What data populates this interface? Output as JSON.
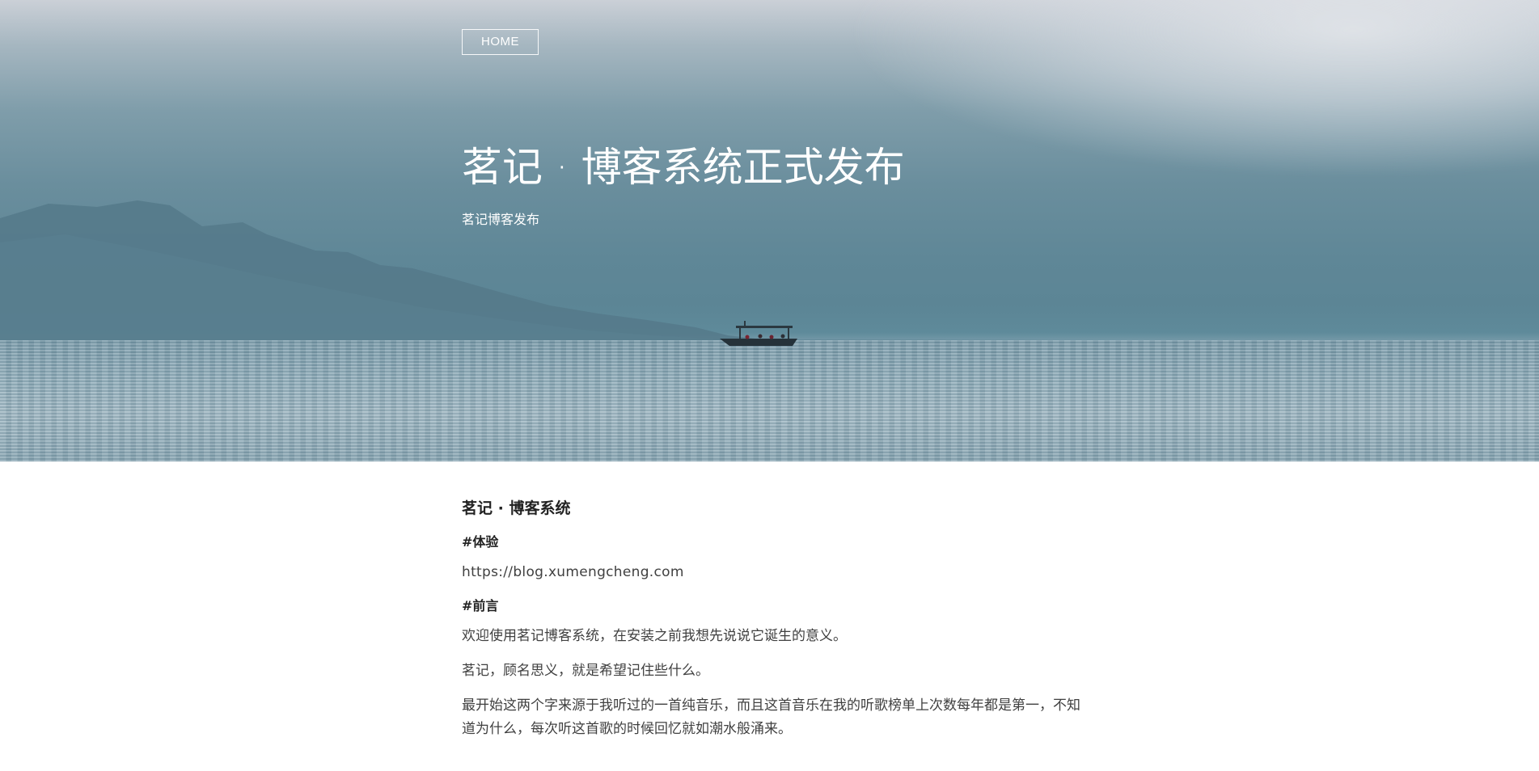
{
  "header": {
    "home_label": "HOME",
    "title": "茗记 · 博客系统正式发布",
    "subtitle": "茗记博客发布"
  },
  "article": {
    "heading": "茗记 · 博客系统",
    "section_experience": "#体验",
    "url": "https://blog.xumengcheng.com",
    "section_preface": "#前言",
    "paragraphs": [
      "欢迎使用茗记博客系统，在安装之前我想先说说它诞生的意义。",
      "茗记，顾名思义，就是希望记住些什么。",
      "最开始这两个字来源于我听过的一首纯音乐，而且这首音乐在我的听歌榜单上次数每年都是第一，不知道为什么，每次听这首歌的时候回忆就如潮水般涌来。"
    ]
  },
  "colors": {
    "hero_sky": "#6a8e9d",
    "hero_sea": "#93b0bd",
    "text_primary": "#222222",
    "text_body": "#404040",
    "background": "#ffffff"
  }
}
